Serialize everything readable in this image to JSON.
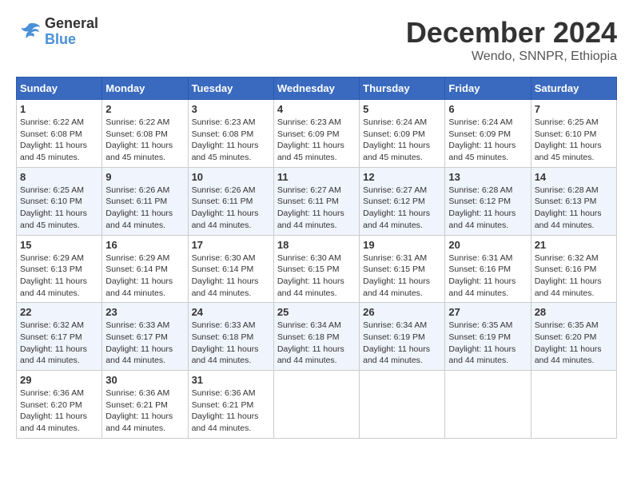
{
  "logo": {
    "line1": "General",
    "line2": "Blue"
  },
  "title": "December 2024",
  "location": "Wendo, SNNPR, Ethiopia",
  "days_of_week": [
    "Sunday",
    "Monday",
    "Tuesday",
    "Wednesday",
    "Thursday",
    "Friday",
    "Saturday"
  ],
  "weeks": [
    [
      {
        "day": "1",
        "sunrise": "6:22 AM",
        "sunset": "6:08 PM",
        "daylight": "11 hours and 45 minutes."
      },
      {
        "day": "2",
        "sunrise": "6:22 AM",
        "sunset": "6:08 PM",
        "daylight": "11 hours and 45 minutes."
      },
      {
        "day": "3",
        "sunrise": "6:23 AM",
        "sunset": "6:08 PM",
        "daylight": "11 hours and 45 minutes."
      },
      {
        "day": "4",
        "sunrise": "6:23 AM",
        "sunset": "6:09 PM",
        "daylight": "11 hours and 45 minutes."
      },
      {
        "day": "5",
        "sunrise": "6:24 AM",
        "sunset": "6:09 PM",
        "daylight": "11 hours and 45 minutes."
      },
      {
        "day": "6",
        "sunrise": "6:24 AM",
        "sunset": "6:09 PM",
        "daylight": "11 hours and 45 minutes."
      },
      {
        "day": "7",
        "sunrise": "6:25 AM",
        "sunset": "6:10 PM",
        "daylight": "11 hours and 45 minutes."
      }
    ],
    [
      {
        "day": "8",
        "sunrise": "6:25 AM",
        "sunset": "6:10 PM",
        "daylight": "11 hours and 45 minutes."
      },
      {
        "day": "9",
        "sunrise": "6:26 AM",
        "sunset": "6:11 PM",
        "daylight": "11 hours and 44 minutes."
      },
      {
        "day": "10",
        "sunrise": "6:26 AM",
        "sunset": "6:11 PM",
        "daylight": "11 hours and 44 minutes."
      },
      {
        "day": "11",
        "sunrise": "6:27 AM",
        "sunset": "6:11 PM",
        "daylight": "11 hours and 44 minutes."
      },
      {
        "day": "12",
        "sunrise": "6:27 AM",
        "sunset": "6:12 PM",
        "daylight": "11 hours and 44 minutes."
      },
      {
        "day": "13",
        "sunrise": "6:28 AM",
        "sunset": "6:12 PM",
        "daylight": "11 hours and 44 minutes."
      },
      {
        "day": "14",
        "sunrise": "6:28 AM",
        "sunset": "6:13 PM",
        "daylight": "11 hours and 44 minutes."
      }
    ],
    [
      {
        "day": "15",
        "sunrise": "6:29 AM",
        "sunset": "6:13 PM",
        "daylight": "11 hours and 44 minutes."
      },
      {
        "day": "16",
        "sunrise": "6:29 AM",
        "sunset": "6:14 PM",
        "daylight": "11 hours and 44 minutes."
      },
      {
        "day": "17",
        "sunrise": "6:30 AM",
        "sunset": "6:14 PM",
        "daylight": "11 hours and 44 minutes."
      },
      {
        "day": "18",
        "sunrise": "6:30 AM",
        "sunset": "6:15 PM",
        "daylight": "11 hours and 44 minutes."
      },
      {
        "day": "19",
        "sunrise": "6:31 AM",
        "sunset": "6:15 PM",
        "daylight": "11 hours and 44 minutes."
      },
      {
        "day": "20",
        "sunrise": "6:31 AM",
        "sunset": "6:16 PM",
        "daylight": "11 hours and 44 minutes."
      },
      {
        "day": "21",
        "sunrise": "6:32 AM",
        "sunset": "6:16 PM",
        "daylight": "11 hours and 44 minutes."
      }
    ],
    [
      {
        "day": "22",
        "sunrise": "6:32 AM",
        "sunset": "6:17 PM",
        "daylight": "11 hours and 44 minutes."
      },
      {
        "day": "23",
        "sunrise": "6:33 AM",
        "sunset": "6:17 PM",
        "daylight": "11 hours and 44 minutes."
      },
      {
        "day": "24",
        "sunrise": "6:33 AM",
        "sunset": "6:18 PM",
        "daylight": "11 hours and 44 minutes."
      },
      {
        "day": "25",
        "sunrise": "6:34 AM",
        "sunset": "6:18 PM",
        "daylight": "11 hours and 44 minutes."
      },
      {
        "day": "26",
        "sunrise": "6:34 AM",
        "sunset": "6:19 PM",
        "daylight": "11 hours and 44 minutes."
      },
      {
        "day": "27",
        "sunrise": "6:35 AM",
        "sunset": "6:19 PM",
        "daylight": "11 hours and 44 minutes."
      },
      {
        "day": "28",
        "sunrise": "6:35 AM",
        "sunset": "6:20 PM",
        "daylight": "11 hours and 44 minutes."
      }
    ],
    [
      {
        "day": "29",
        "sunrise": "6:36 AM",
        "sunset": "6:20 PM",
        "daylight": "11 hours and 44 minutes."
      },
      {
        "day": "30",
        "sunrise": "6:36 AM",
        "sunset": "6:21 PM",
        "daylight": "11 hours and 44 minutes."
      },
      {
        "day": "31",
        "sunrise": "6:36 AM",
        "sunset": "6:21 PM",
        "daylight": "11 hours and 44 minutes."
      },
      null,
      null,
      null,
      null
    ]
  ]
}
